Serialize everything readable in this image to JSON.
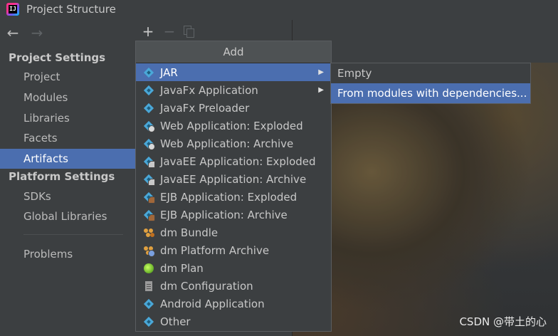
{
  "window": {
    "title": "Project Structure"
  },
  "sidebar": {
    "section_project": "Project Settings",
    "project_items": [
      {
        "label": "Project"
      },
      {
        "label": "Modules"
      },
      {
        "label": "Libraries"
      },
      {
        "label": "Facets"
      },
      {
        "label": "Artifacts",
        "selected": true
      }
    ],
    "section_platform": "Platform Settings",
    "platform_items": [
      {
        "label": "SDKs"
      },
      {
        "label": "Global Libraries"
      }
    ],
    "problems": "Problems"
  },
  "toolbar": {
    "add": "+",
    "remove": "−"
  },
  "popup": {
    "header": "Add",
    "items": [
      {
        "label": "JAR",
        "icon": "jar-icon",
        "submenu": true,
        "selected": true
      },
      {
        "label": "JavaFx Application",
        "icon": "javafx-application-icon",
        "submenu": true
      },
      {
        "label": "JavaFx Preloader",
        "icon": "javafx-preloader-icon"
      },
      {
        "label": "Web Application: Exploded",
        "icon": "web-application-icon"
      },
      {
        "label": "Web Application: Archive",
        "icon": "web-application-icon"
      },
      {
        "label": "JavaEE Application: Exploded",
        "icon": "javaee-application-icon"
      },
      {
        "label": "JavaEE Application: Archive",
        "icon": "javaee-application-icon"
      },
      {
        "label": "EJB Application: Exploded",
        "icon": "ejb-application-icon"
      },
      {
        "label": "EJB Application: Archive",
        "icon": "ejb-application-icon"
      },
      {
        "label": "dm Bundle",
        "icon": "dm-bundle-icon"
      },
      {
        "label": "dm Platform Archive",
        "icon": "dm-platform-archive-icon"
      },
      {
        "label": "dm Plan",
        "icon": "dm-plan-icon"
      },
      {
        "label": "dm Configuration",
        "icon": "dm-configuration-icon"
      },
      {
        "label": "Android Application",
        "icon": "android-application-icon"
      },
      {
        "label": "Other",
        "icon": "other-artifact-icon"
      }
    ]
  },
  "submenu": {
    "items": [
      {
        "label": "Empty"
      },
      {
        "label": "From modules with dependencies...",
        "selected": true
      }
    ]
  },
  "watermark": "CSDN @带土的心"
}
